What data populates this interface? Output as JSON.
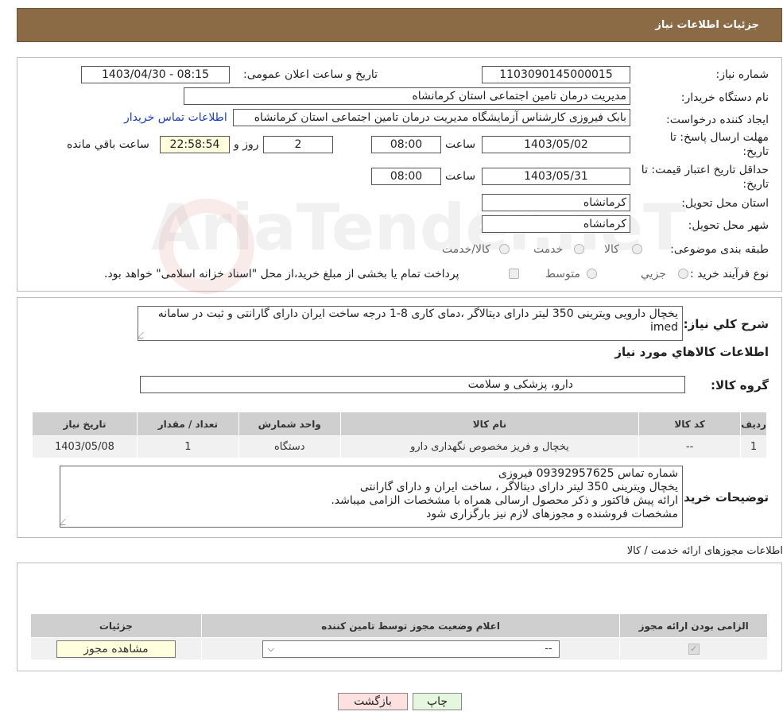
{
  "header": {
    "title": "جزئیات اطلاعات نیاز"
  },
  "watermark": {
    "text": "AriaTender.neT"
  },
  "form": {
    "need_number_label": "شماره نیاز:",
    "need_number": "1103090145000015",
    "announce_label": "تاریخ و ساعت اعلان عمومی:",
    "announce_value": "1403/04/30 - 08:15",
    "buyer_label": "نام دستگاه خریدار:",
    "buyer_value": "مدیریت درمان تامین اجتماعی استان کرمانشاه",
    "creator_label": "ایجاد کننده درخواست:",
    "creator_value": "بابک فیروزی کارشناس آزمایشگاه مدیریت درمان تامین اجتماعی استان کرمانشاه",
    "contact_link": "اطلاعات تماس خریدار",
    "deadline_label_1": "مهلت ارسال پاسخ: تا",
    "deadline_label_2": "تاریخ:",
    "deadline_date": "1403/05/02",
    "time_label": "ساعت",
    "deadline_time": "08:00",
    "days_value": "2",
    "days_label": "روز و",
    "remaining_time": "22:58:54",
    "remaining_label": "ساعت باقي مانده",
    "validity_label_1": "حداقل تاریخ اعتبار قیمت: تا",
    "validity_label_2": "تاریخ:",
    "validity_date": "1403/05/31",
    "validity_time": "08:00",
    "province_label": "استان محل تحویل:",
    "province_value": "کرمانشاه",
    "city_label": "شهر محل تحویل:",
    "city_value": "کرمانشاه",
    "category_label": "طبقه بندی موضوعی:",
    "category_options": [
      "کالا",
      "خدمت",
      "کالا/خدمت"
    ],
    "process_label": "نوع فرآیند خرید :",
    "process_options": [
      "جزیي",
      "متوسط"
    ],
    "process_note": "پرداخت تمام یا بخشی از مبلغ خرید،از محل \"اسناد خزانه اسلامی\" خواهد بود."
  },
  "description": {
    "label": "شرح كلي نياز:",
    "text": "یخچال دارویی ویترینی 350 لیتر دارای دیتالاگر ،دمای کاری 8-1 درجه ساخت ایران دارای گارانتی و ثبت در سامانه imed"
  },
  "goods": {
    "section_title": "اطلاعات کالاهاي مورد نياز",
    "group_label": "گروه کالا:",
    "group_value": "دارو، پزشکی و سلامت",
    "columns": [
      "رديف",
      "کد کالا",
      "نام کالا",
      "واحد شمارش",
      "تعداد / مقدار",
      "تاریخ نیاز"
    ],
    "rows": [
      [
        "1",
        "--",
        "یخچال و فریز مخصوص نگهداری دارو",
        "دستگاه",
        "1",
        "1403/05/08"
      ]
    ],
    "buyer_notes_label": "توضیحات خریدار:",
    "buyer_notes": [
      "شماره تماس 09392957625 فیروزی",
      "یخچال ویترینی 350 لیتر دارای دیتالاگر ، ساخت ایران و دارای گارانتی",
      "ارائه پیش فاکتور  و ذکر محصول ارسالی همراه با مشخصات الزامی میباشد.",
      "مشخصات فروشنده و مجوزهای لازم نیز بارگزاری شود"
    ]
  },
  "permits": {
    "section_title": "اطلاعات مجوزهای ارائه خدمت / کالا",
    "columns": [
      "الزامی بودن ارائه مجوز",
      "اعلام وضعیت مجوز توسط تامین کننده",
      "جزئیات"
    ],
    "select_value": "--",
    "view_button": "مشاهده مجوز"
  },
  "buttons": {
    "print": "چاپ",
    "back": "بازگشت"
  }
}
